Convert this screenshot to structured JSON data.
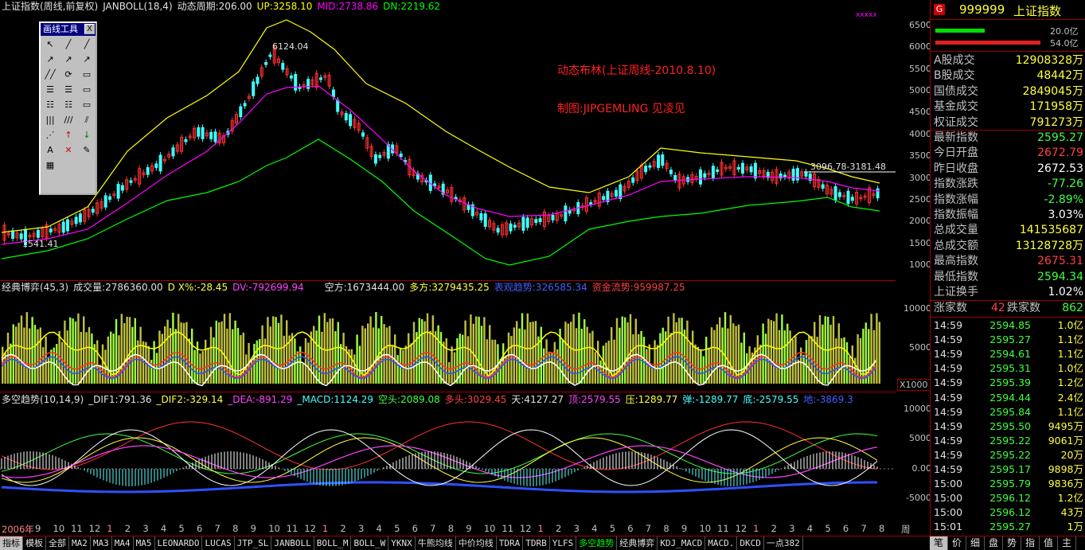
{
  "main_panel": {
    "title": "上证指数(周线,前复权)",
    "indicator": "JANBOLL(18,4)",
    "period_label": "动态周期:206.00",
    "up": "UP:3258.10",
    "mid": "MID:2738.86",
    "dn": "DN:2219.62",
    "high_label": "6124.04",
    "low_label": "1541.41",
    "right_label": "3096.78-3181.48",
    "annotation_1": "动态布林(上证周线-2010.8.10)",
    "annotation_2": "制图:JIPGEMLING 见凌见",
    "xmark": "xxxxx",
    "y_ticks": [
      "6500",
      "6000",
      "5500",
      "5000",
      "4500",
      "4000",
      "3500",
      "3000",
      "2500",
      "2000",
      "1500",
      "1000"
    ]
  },
  "mid_panel": {
    "title": "经典博弈(45,3)",
    "volume": "成交量:2786360.00",
    "dx": "D X%:-28.45",
    "dv": "DV:-792699.94",
    "kong": "空方:1673444.00",
    "duo": "多方:3279435.25",
    "biaoxian": "表观趋势:326585.34",
    "zijin": "资金流势:959987.25",
    "y_ticks": [
      "10000",
      "5000"
    ],
    "unit": "X1000"
  },
  "low_panel": {
    "title": "多空趋势(10,14,9)",
    "dif1": "_DIF1:791.36",
    "dif2": "_DIF2:-329.14",
    "dea": "_DEA:-891.29",
    "macd": "_MACD:1124.29",
    "kongtou": "空头:2089.08",
    "duotou": "多头:3029.45",
    "tian": "天:4127.27",
    "ding": "顶:2579.55",
    "ya": "压:1289.77",
    "tan": "弹:-1289.77",
    "di": "底:-2579.55",
    "di2": "地:-3869.3",
    "y_ticks": [
      "10000",
      "5000",
      "0.00",
      "-5000"
    ]
  },
  "x_axis": {
    "year": "2006年",
    "months": [
      "9",
      "10",
      "11",
      "12",
      "1",
      "2",
      "3",
      "4",
      "5",
      "6",
      "7",
      "8",
      "9",
      "10",
      "11",
      "12",
      "1",
      "2",
      "3",
      "4",
      "5",
      "6",
      "7",
      "8",
      "9",
      "10",
      "11",
      "12",
      "1",
      "2",
      "3",
      "4",
      "5",
      "6",
      "7",
      "8",
      "9",
      "10",
      "11",
      "12",
      "1",
      "2",
      "3",
      "4",
      "5",
      "6",
      "7",
      "8"
    ],
    "period": "周线"
  },
  "toolbox": {
    "title": "画线工具",
    "close": "X",
    "tools": [
      "↖",
      "╱",
      "╱",
      "↗",
      "↗",
      "↗",
      "╱╱",
      "⟳",
      "▭",
      "☰",
      "☰",
      "▭",
      "☷",
      "☷",
      "▭",
      "|||",
      "///",
      "⫽",
      "⋰",
      "↑",
      "↓",
      "A",
      "✕",
      "✎",
      "▦"
    ]
  },
  "side": {
    "code": "999999",
    "name": "上证指数",
    "g_badge": "G",
    "bar1_label": "20.0亿",
    "bar2_label": "54.0亿",
    "stats": [
      {
        "label": "A股成交",
        "value": "12908328万",
        "color": "#ffff40"
      },
      {
        "label": "B股成交",
        "value": "48442万",
        "color": "#ffff40"
      },
      {
        "label": "国债成交",
        "value": "2849045万",
        "color": "#ffff40"
      },
      {
        "label": "基金成交",
        "value": "171958万",
        "color": "#ffff40"
      },
      {
        "label": "权证成交",
        "value": "791273万",
        "color": "#ffff40"
      },
      {
        "label": "最新指数",
        "value": "2595.27",
        "color": "#40ff40"
      },
      {
        "label": "今日开盘",
        "value": "2672.79",
        "color": "#ff4040"
      },
      {
        "label": "昨日收盘",
        "value": "2672.53",
        "color": "#ffffff"
      },
      {
        "label": "指数涨跌",
        "value": "-77.26",
        "color": "#40ff40"
      },
      {
        "label": "指数涨幅",
        "value": "-2.89%",
        "color": "#40ff40"
      },
      {
        "label": "指数振幅",
        "value": "3.03%",
        "color": "#ffffff"
      },
      {
        "label": "总成交量",
        "value": "141535687",
        "color": "#ffff40"
      },
      {
        "label": "总成交额",
        "value": "13128728万",
        "color": "#ffff40"
      },
      {
        "label": "最高指数",
        "value": "2675.31",
        "color": "#ff4040"
      },
      {
        "label": "最低指数",
        "value": "2594.34",
        "color": "#40ff40"
      },
      {
        "label": "上证换手",
        "value": "1.02%",
        "color": "#ffffff"
      }
    ],
    "rise_label": "涨家数",
    "rise_value": "42",
    "fall_label": "跌家数",
    "fall_value": "862",
    "ticks": [
      {
        "time": "14:59",
        "price": "2594.85",
        "vol": "1.0亿"
      },
      {
        "time": "14:59",
        "price": "2595.27",
        "vol": "1.1亿"
      },
      {
        "time": "14:59",
        "price": "2594.61",
        "vol": "1.1亿"
      },
      {
        "time": "14:59",
        "price": "2595.31",
        "vol": "1.0亿"
      },
      {
        "time": "14:59",
        "price": "2595.39",
        "vol": "1.2亿"
      },
      {
        "time": "14:59",
        "price": "2594.44",
        "vol": "2.4亿"
      },
      {
        "time": "14:59",
        "price": "2595.84",
        "vol": "1.1亿"
      },
      {
        "time": "14:59",
        "price": "2595.50",
        "vol": "9495万"
      },
      {
        "time": "14:59",
        "price": "2595.22",
        "vol": "9061万"
      },
      {
        "time": "14:59",
        "price": "2595.22",
        "vol": "20万"
      },
      {
        "time": "14:59",
        "price": "2595.17",
        "vol": "9898万"
      },
      {
        "time": "15:00",
        "price": "2595.79",
        "vol": "9836万"
      },
      {
        "time": "15:00",
        "price": "2596.12",
        "vol": "1.2亿"
      },
      {
        "time": "15:00",
        "price": "2596.12",
        "vol": "43万"
      },
      {
        "time": "15:01",
        "price": "2595.27",
        "vol": "1万"
      }
    ]
  },
  "tabs": [
    "指标",
    "模板",
    "全部",
    "MA2",
    "MA3",
    "MA4",
    "MA5",
    "LEONARDO",
    "LUCAS",
    "JTP_SL",
    "JANBOLL",
    "BOLL_M",
    "BOLL_W",
    "YKNX",
    "牛熊均线",
    "中价均线",
    "TDRA",
    "TDRB",
    "YLFS",
    "多空趋势",
    "经典博弈",
    "KDJ_MACD",
    "MACD.",
    "DKCD",
    "一点382"
  ],
  "active_tab": "多空趋势",
  "side_tabs": [
    "笔",
    "价",
    "细",
    "盘",
    "势",
    "指",
    "值",
    "主"
  ],
  "colors": {
    "up": "#ffff00",
    "mid": "#ff00ff",
    "dn": "#00ff00",
    "candle_up": "#ff3030",
    "candle_down": "#40ffff",
    "border": "#a00000"
  }
}
